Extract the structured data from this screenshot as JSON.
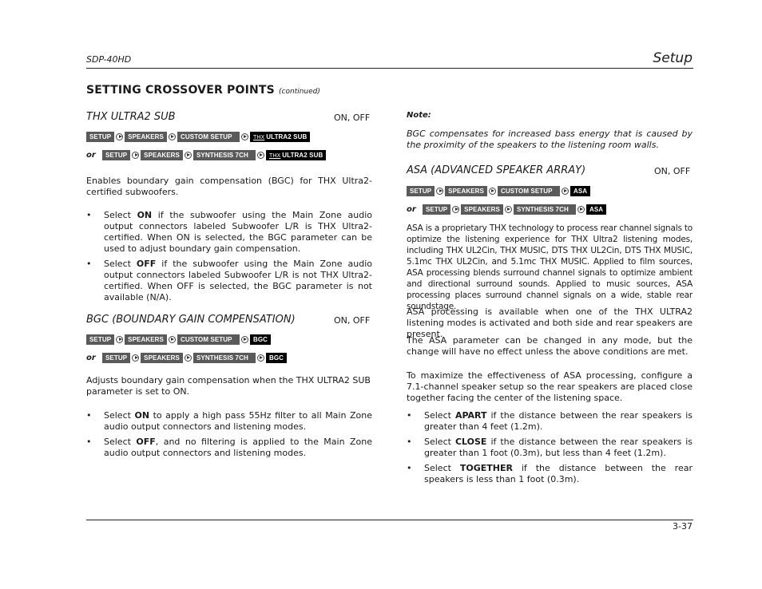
{
  "header": {
    "model": "SDP-40HD",
    "section": "Setup"
  },
  "footer": {
    "page": "3-37"
  },
  "section_title": "SETTING CROSSOVER POINTS",
  "section_cont": "(continued)",
  "left": {
    "thx": {
      "title": "THX ULTRA2 SUB",
      "options": "ON, OFF",
      "path1": [
        "SETUP",
        "SPEAKERS",
        "CUSTOM SETUP",
        "ULTRA2 SUB"
      ],
      "path2": [
        "SETUP",
        "SPEAKERS",
        "SYNTHESIS 7CH",
        "ULTRA2 SUB"
      ],
      "thx_logo": "THX",
      "or": "or",
      "desc": "Enables boundary gain compensation (BGC) for THX Ultra2-certified subwoofers.",
      "bullets": [
        {
          "pre": "Select ",
          "bold": "ON",
          "post": " if the subwoofer using the Main Zone audio output connectors labeled Subwoofer L/R is THX Ultra2-certified. When ON is selected, the BGC parameter can be used to adjust boundary gain compensation."
        },
        {
          "pre": "Select ",
          "bold": "OFF",
          "post": " if the subwoofer using the Main Zone audio output connectors labeled Subwoofer L/R is not THX Ultra2-certified. When OFF is selected, the BGC parameter is not available (N/A)."
        }
      ]
    },
    "bgc": {
      "title": "BGC (BOUNDARY GAIN COMPENSATION)",
      "options": "ON, OFF",
      "path1": [
        "SETUP",
        "SPEAKERS",
        "CUSTOM SETUP",
        "BGC"
      ],
      "path2": [
        "SETUP",
        "SPEAKERS",
        "SYNTHESIS 7CH",
        "BGC"
      ],
      "or": "or",
      "desc": "Adjusts boundary gain compensation when the THX ULTRA2 SUB parameter is set to ON.",
      "bullets": [
        {
          "pre": "Select ",
          "bold": "ON",
          "post": " to apply a high pass 55Hz filter to all Main Zone audio output connectors and listening modes."
        },
        {
          "pre": "Select ",
          "bold": "OFF",
          "post": ", and no filtering is applied to the Main Zone audio output connectors and listening modes."
        }
      ]
    }
  },
  "right": {
    "note_label": "Note:",
    "note_text": "BGC compensates for increased bass energy that is caused by the proximity of the speakers to the listening room walls.",
    "asa": {
      "title": "ASA (ADVANCED SPEAKER ARRAY)",
      "options": "ON, OFF",
      "path1": [
        "SETUP",
        "SPEAKERS",
        "CUSTOM SETUP",
        "ASA"
      ],
      "path2": [
        "SETUP",
        "SPEAKERS",
        "SYNTHESIS 7CH",
        "ASA"
      ],
      "or": "or",
      "p1": "ASA is a proprietary THX technology to process rear channel signals to optimize the listening experience for THX Ultra2 listening modes, including THX UL2Cin, THX MUSIC, DTS THX UL2Cin, DTS THX MUSIC, 5.1mc THX UL2Cin, and 5.1mc THX MUSIC. Applied to film sources, ASA processing blends surround channel signals to optimize ambient and directional surround sounds. Applied to music sources, ASA processing places surround channel signals on a wide, stable rear soundstage.",
      "p2": "ASA processing is available when one of the THX ULTRA2 listening modes is activated and both side and rear speakers are present.",
      "p3": "The ASA parameter can be changed in any mode, but the change will have no effect unless the above conditions are met.",
      "p4": "To maximize the effectiveness of ASA processing, configure a 7.1-channel speaker setup so the rear speakers are placed close together facing the center of the listening space.",
      "bullets": [
        {
          "pre": "Select ",
          "bold": "APART",
          "post": " if the distance between the rear speakers is greater than 4 feet (1.2m)."
        },
        {
          "pre": "Select ",
          "bold": "CLOSE",
          "post": " if the distance between the rear speakers is greater than 1 foot (0.3m), but less than 4 feet (1.2m)."
        },
        {
          "pre": "Select ",
          "bold": "TOGETHER",
          "post": " if the distance between the rear speakers is less than 1 foot (0.3m)."
        }
      ]
    }
  }
}
